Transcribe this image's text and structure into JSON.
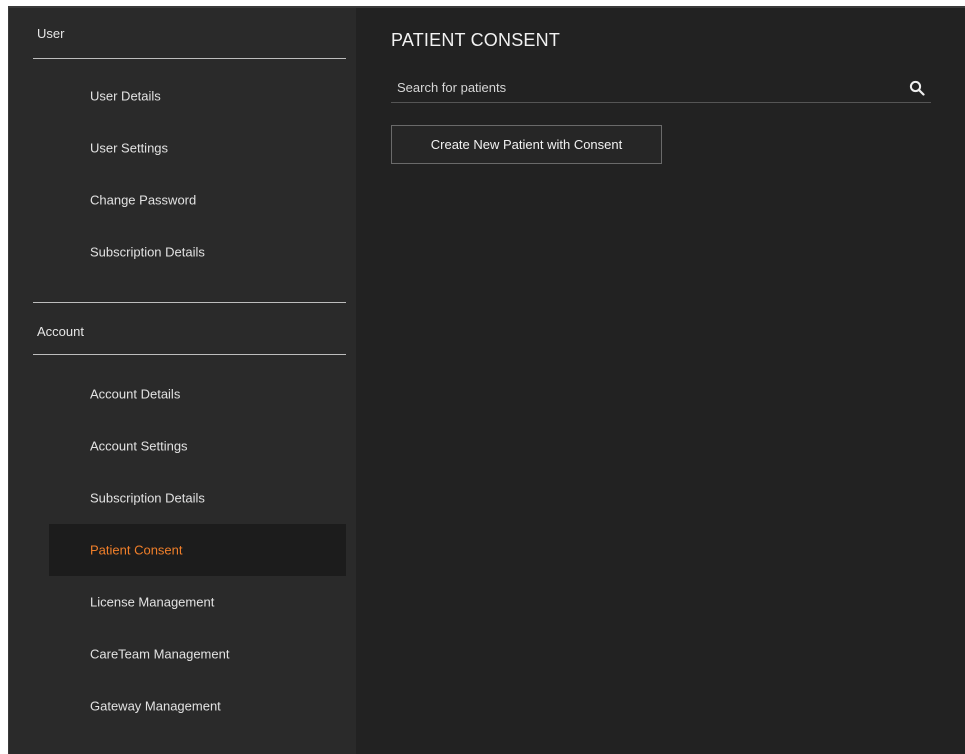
{
  "sidebar": {
    "sections": [
      {
        "title": "User",
        "items": [
          {
            "label": "User Details"
          },
          {
            "label": "User Settings"
          },
          {
            "label": "Change Password"
          },
          {
            "label": "Subscription Details"
          }
        ]
      },
      {
        "title": "Account",
        "items": [
          {
            "label": "Account Details"
          },
          {
            "label": "Account Settings"
          },
          {
            "label": "Subscription Details"
          },
          {
            "label": "Patient Consent",
            "active": true
          },
          {
            "label": "License Management"
          },
          {
            "label": "CareTeam Management"
          },
          {
            "label": "Gateway Management"
          }
        ]
      }
    ]
  },
  "main": {
    "title": "PATIENT CONSENT",
    "search": {
      "placeholder": "Search for patients",
      "value": "",
      "icon": "search-icon"
    },
    "create_button_label": "Create New Patient with Consent"
  },
  "colors": {
    "background": "#222222",
    "sidebar_background": "#2a2a2a",
    "active_item_text": "#f07f2a",
    "active_item_background": "#1c1c1c",
    "text": "#e2e2e2"
  }
}
